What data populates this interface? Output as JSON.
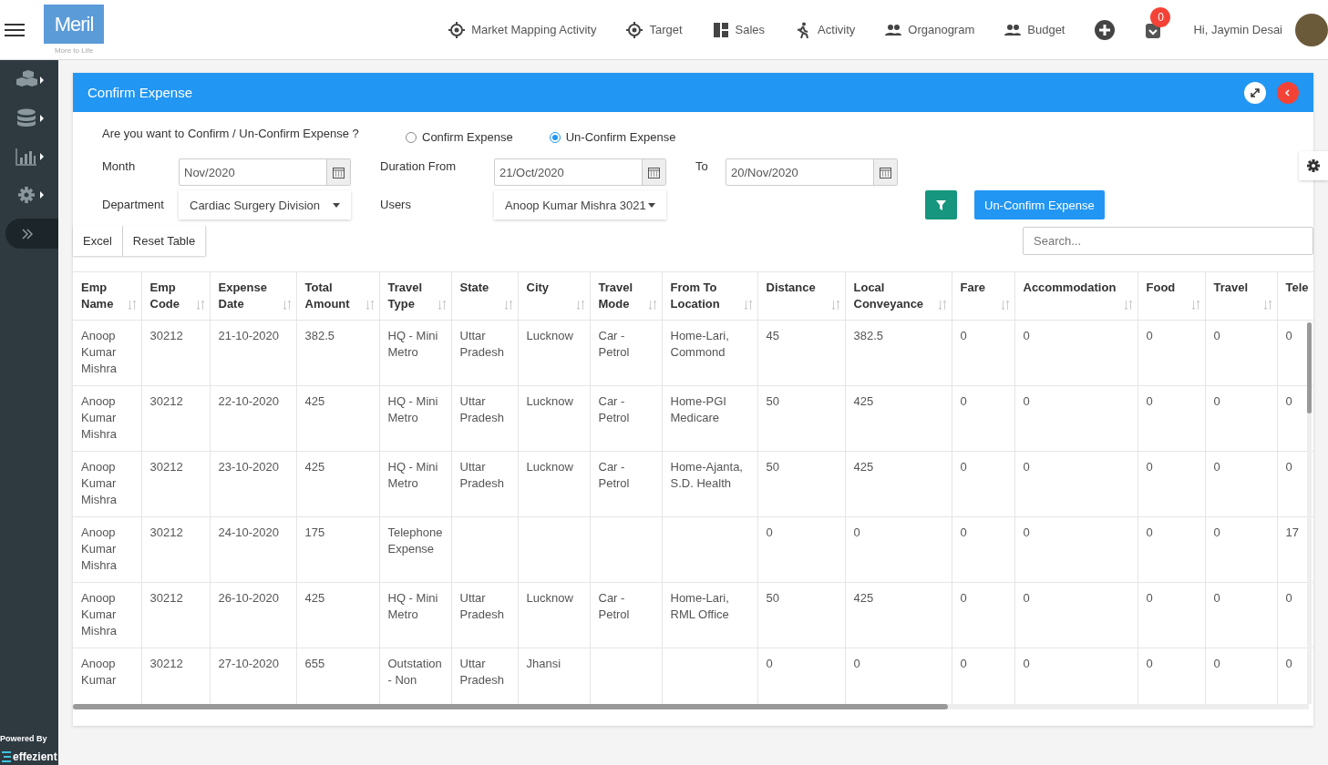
{
  "header": {
    "logo": {
      "brand": "Meril",
      "tagline": "More to Life"
    },
    "nav": [
      {
        "label": "Market Mapping Activity"
      },
      {
        "label": "Target"
      },
      {
        "label": "Sales"
      },
      {
        "label": "Activity"
      },
      {
        "label": "Organogram"
      },
      {
        "label": "Budget"
      }
    ],
    "notification_count": "0",
    "greeting": "Hi, Jaymin Desai"
  },
  "sidebar": {
    "powered_by": "Powered By",
    "brand": "effezient"
  },
  "panel": {
    "title": "Confirm Expense",
    "question": "Are you want to Confirm / Un-Confirm Expense ?",
    "radios": [
      {
        "label": "Confirm Expense",
        "selected": false
      },
      {
        "label": "Un-Confirm Expense",
        "selected": true
      }
    ],
    "month": {
      "label": "Month",
      "value": "Nov/2020"
    },
    "duration_from": {
      "label": "Duration From",
      "value": "21/Oct/2020"
    },
    "to": {
      "label": "To",
      "value": "20/Nov/2020"
    },
    "department": {
      "label": "Department",
      "value": "Cardiac Surgery Division"
    },
    "users": {
      "label": "Users",
      "value": "Anoop Kumar Mishra 3021"
    },
    "action_button": "Un-Confirm Expense",
    "table_buttons": [
      "Excel",
      "Reset Table"
    ],
    "search": {
      "placeholder": "Search..."
    }
  },
  "table": {
    "columns": [
      {
        "label": "Emp Name",
        "sortable": true
      },
      {
        "label": "Emp Code",
        "sortable": true
      },
      {
        "label": "Expense Date",
        "sortable": true
      },
      {
        "label": "Total Amount",
        "sortable": true
      },
      {
        "label": "Travel Type",
        "sortable": true
      },
      {
        "label": "State",
        "sortable": true
      },
      {
        "label": "City",
        "sortable": true
      },
      {
        "label": "Travel Mode",
        "sortable": true
      },
      {
        "label": "From To Location",
        "sortable": true
      },
      {
        "label": "Distance",
        "sortable": true
      },
      {
        "label": "Local Conveyance",
        "sortable": true
      },
      {
        "label": "Fare",
        "sortable": true
      },
      {
        "label": "Accommodation",
        "sortable": true
      },
      {
        "label": "Food",
        "sortable": true
      },
      {
        "label": "Travel",
        "sortable": true
      },
      {
        "label": "Tele",
        "sortable": false
      }
    ],
    "rows": [
      [
        "Anoop Kumar Mishra",
        "30212",
        "21-10-2020",
        "382.5",
        "HQ - Mini Metro",
        "Uttar Pradesh",
        "Lucknow",
        "Car - Petrol",
        "Home-Lari, Commond",
        "45",
        "382.5",
        "0",
        "0",
        "0",
        "0",
        "0"
      ],
      [
        "Anoop Kumar Mishra",
        "30212",
        "22-10-2020",
        "425",
        "HQ - Mini Metro",
        "Uttar Pradesh",
        "Lucknow",
        "Car - Petrol",
        "Home-PGI Medicare",
        "50",
        "425",
        "0",
        "0",
        "0",
        "0",
        "0"
      ],
      [
        "Anoop Kumar Mishra",
        "30212",
        "23-10-2020",
        "425",
        "HQ - Mini Metro",
        "Uttar Pradesh",
        "Lucknow",
        "Car - Petrol",
        "Home-Ajanta, S.D. Health",
        "50",
        "425",
        "0",
        "0",
        "0",
        "0",
        "0"
      ],
      [
        "Anoop Kumar Mishra",
        "30212",
        "24-10-2020",
        "175",
        "Telephone Expense",
        "",
        "",
        "",
        "",
        "0",
        "0",
        "0",
        "0",
        "0",
        "0",
        "17"
      ],
      [
        "Anoop Kumar Mishra",
        "30212",
        "26-10-2020",
        "425",
        "HQ - Mini Metro",
        "Uttar Pradesh",
        "Lucknow",
        "Car - Petrol",
        "Home-Lari, RML Office",
        "50",
        "425",
        "0",
        "0",
        "0",
        "0",
        "0"
      ],
      [
        "Anoop Kumar",
        "30212",
        "27-10-2020",
        "655",
        "Outstation - Non",
        "Uttar Pradesh",
        "Jhansi",
        "",
        "",
        "0",
        "0",
        "0",
        "0",
        "0",
        "0",
        "0"
      ]
    ]
  }
}
